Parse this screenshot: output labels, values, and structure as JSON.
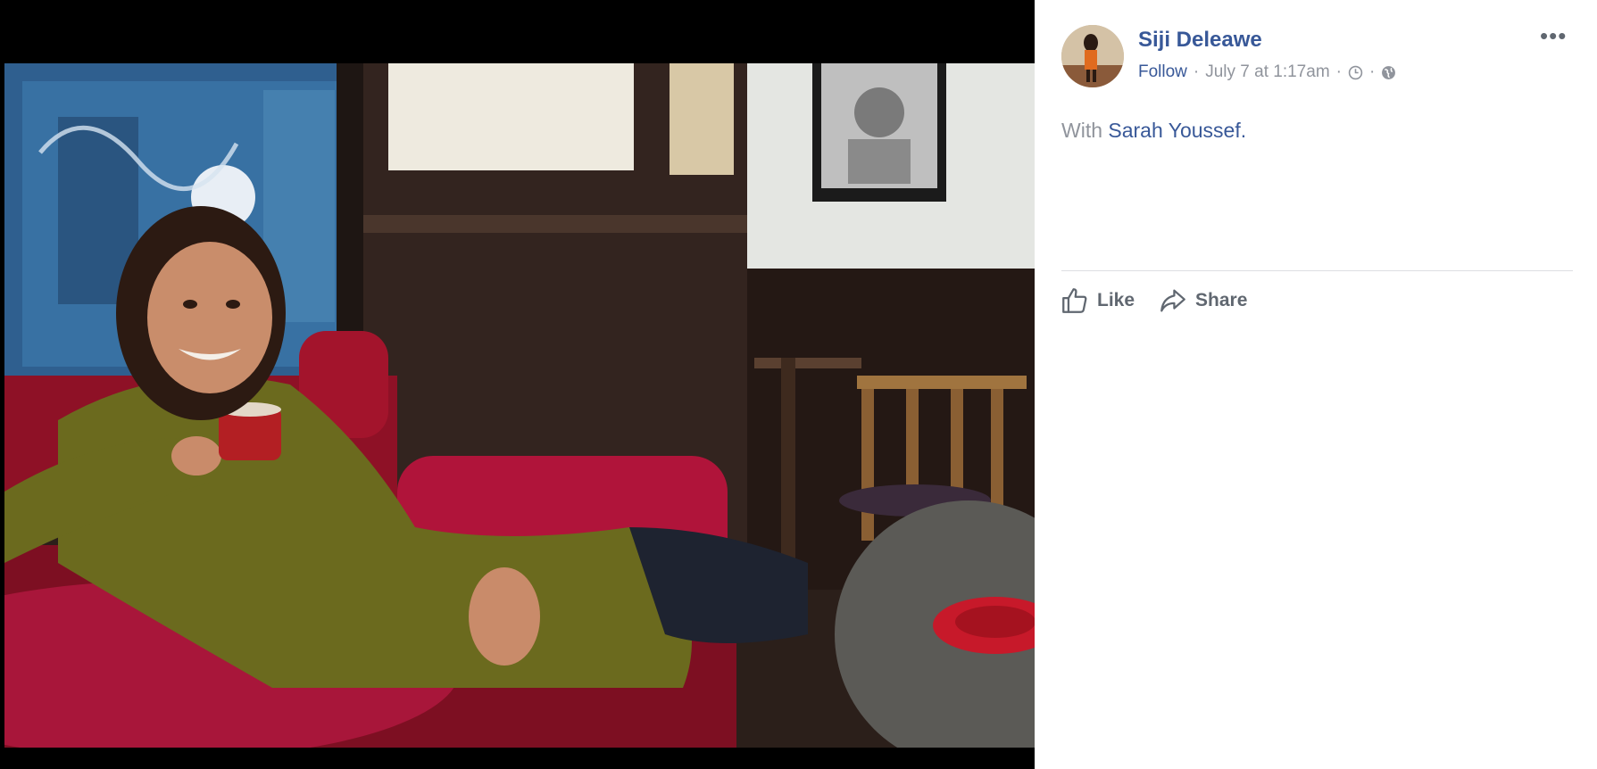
{
  "photo": {
    "description_icon": "photo-of-woman-in-cafe"
  },
  "post": {
    "author": "Siji Deleawe",
    "follow_label": "Follow",
    "separator": "·",
    "timestamp": "July 7 at 1:17am",
    "clock_icon": "clock-icon",
    "privacy_icon": "globe-icon",
    "with_prefix": "With",
    "tagged_person": "Sarah Youssef",
    "tagged_suffix": ".",
    "more_label": "•••"
  },
  "actions": {
    "like_label": "Like",
    "share_label": "Share"
  },
  "colors": {
    "link_blue": "#385898",
    "meta_gray": "#90949c",
    "action_gray": "#606770",
    "divider": "#dddfe2"
  }
}
